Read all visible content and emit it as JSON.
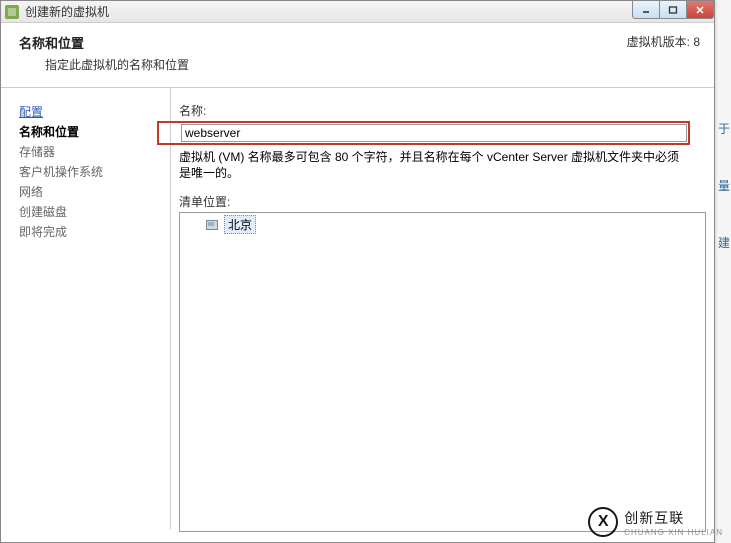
{
  "window": {
    "title": "创建新的虚拟机"
  },
  "header": {
    "title": "名称和位置",
    "subtitle": "指定此虚拟机的名称和位置",
    "version": "虚拟机版本: 8"
  },
  "sidebar": {
    "items": [
      {
        "label": "配置",
        "type": "link"
      },
      {
        "label": "名称和位置",
        "type": "active"
      },
      {
        "label": "存储器",
        "type": "normal"
      },
      {
        "label": "客户机操作系统",
        "type": "normal"
      },
      {
        "label": "网络",
        "type": "normal"
      },
      {
        "label": "创建磁盘",
        "type": "normal"
      },
      {
        "label": "即将完成",
        "type": "normal"
      }
    ]
  },
  "content": {
    "name_label": "名称:",
    "name_value": "webserver",
    "help_text": "虚拟机 (VM) 名称最多可包含 80 个字符，并且名称在每个 vCenter Server 虚拟机文件夹中必须是唯一的。",
    "inventory_label": "清单位置:",
    "tree": {
      "item_label": "北京"
    }
  },
  "logo": {
    "mark": "X",
    "text": "创新互联",
    "sub": "CHUANG XIN HULIAN"
  },
  "side_hints": [
    "于",
    "量",
    "建"
  ]
}
